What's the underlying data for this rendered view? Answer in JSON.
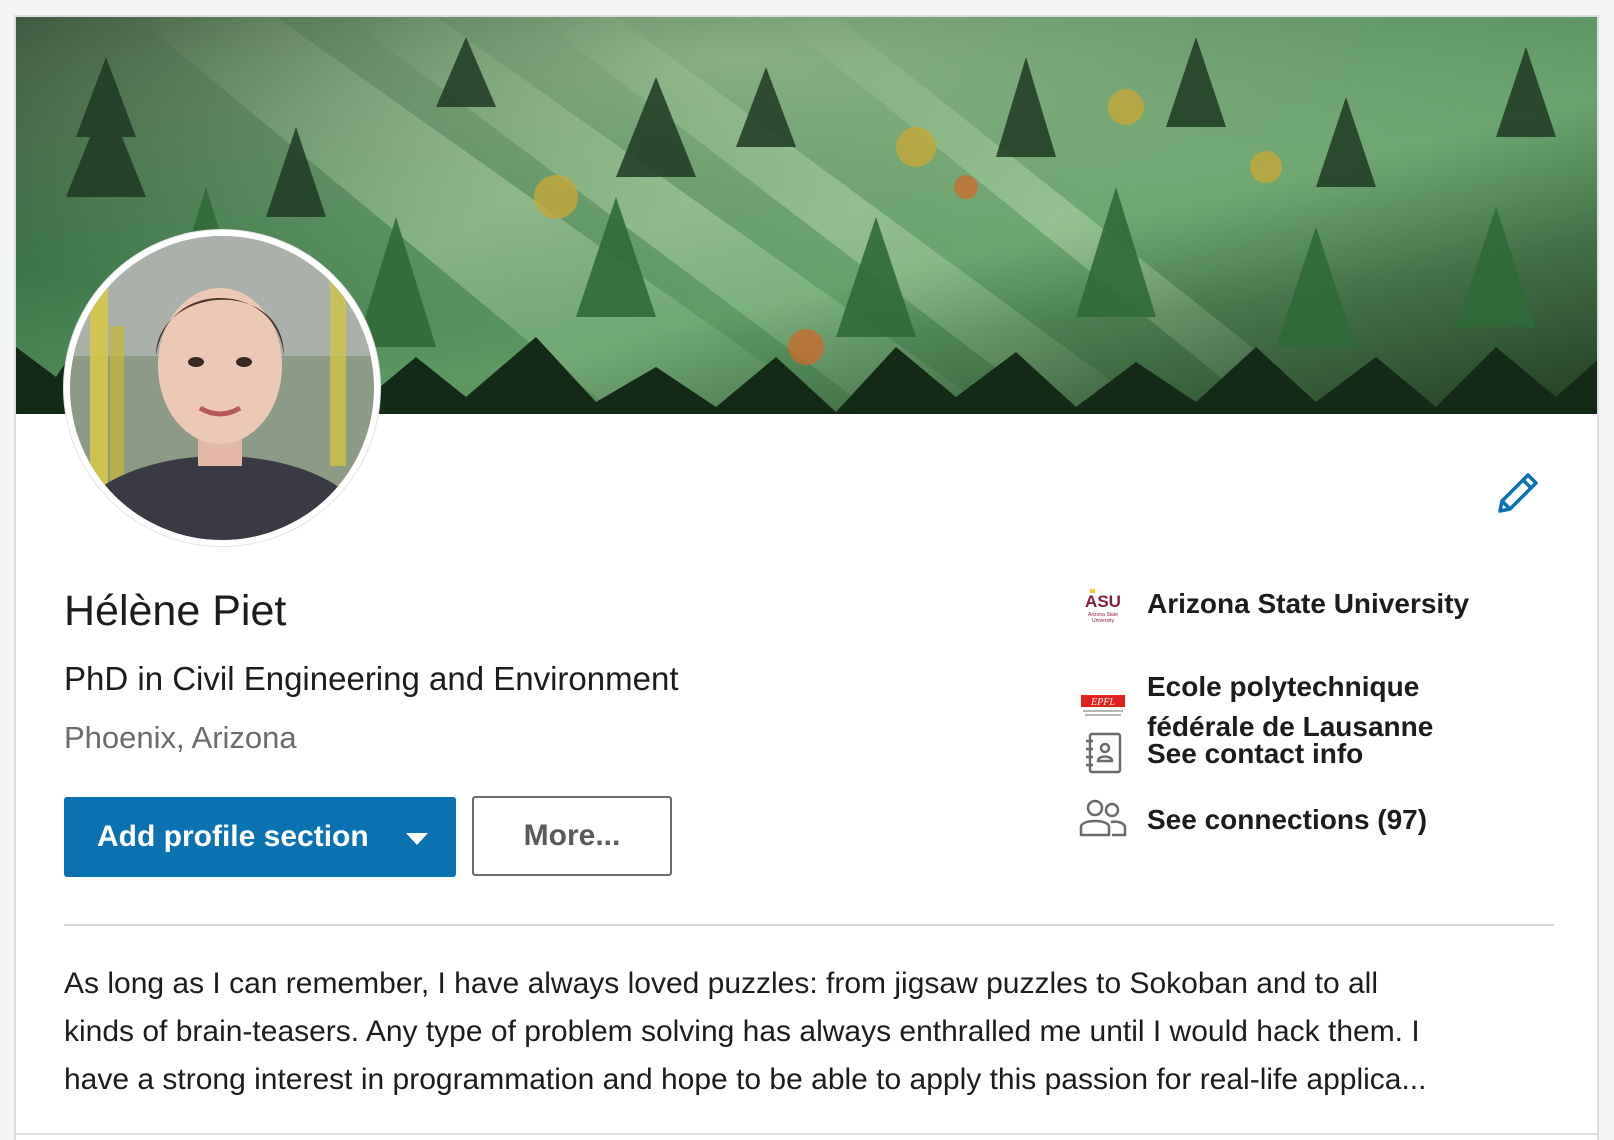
{
  "profile": {
    "name": "Hélène Piet",
    "headline": "PhD in Civil Engineering and Environment",
    "location": "Phoenix, Arizona"
  },
  "actions": {
    "add_section_label": "Add profile section",
    "more_label": "More..."
  },
  "sidebar": {
    "items": [
      {
        "label": "Arizona State University",
        "icon": "asu-logo"
      },
      {
        "label_line1": "Ecole polytechnique",
        "label_line2": "fédérale de Lausanne",
        "icon": "epfl-logo"
      },
      {
        "label": "See contact info",
        "icon": "contact-book-icon"
      },
      {
        "label": "See connections (97)",
        "icon": "people-icon"
      }
    ]
  },
  "logos": {
    "asu": {
      "text": "ASU",
      "caption_line1": "Arizona State",
      "caption_line2": "University"
    },
    "epfl": {
      "text": "EPFL"
    }
  },
  "summary": {
    "line1": "As long as I can remember, I have always loved puzzles: from jigsaw puzzles to Sokoban and to all",
    "line2": "kinds of brain-teasers. Any type of problem solving has always enthralled me until I would hack them. I",
    "line3": "have a strong interest in programmation and hope to be able to apply this passion for real-life applica..."
  },
  "colors": {
    "primary_button": "#0a72b1",
    "edit_icon": "#0a72b1",
    "asu_maroon": "#8c1d40",
    "asu_gold": "#ffc627",
    "epfl_red": "#e2211c"
  }
}
